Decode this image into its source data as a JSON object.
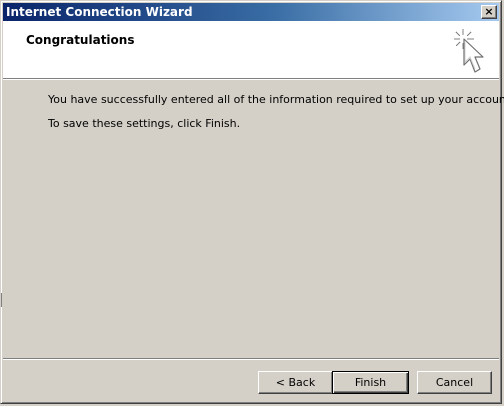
{
  "window": {
    "title": "Internet Connection Wizard",
    "close_glyph": "×"
  },
  "header": {
    "title": "Congratulations",
    "icon": "wizard-sparkle-cursor-icon"
  },
  "body": {
    "line1": "You have successfully entered all of the information required to set up your account.",
    "line2": "To save these settings, click Finish."
  },
  "buttons": {
    "back": "< Back",
    "finish": "Finish",
    "cancel": "Cancel"
  },
  "colors": {
    "titlebar_start": "#0a246a",
    "titlebar_end": "#a6caf0",
    "face": "#d4d0c8",
    "header_background": "#ffffff"
  }
}
